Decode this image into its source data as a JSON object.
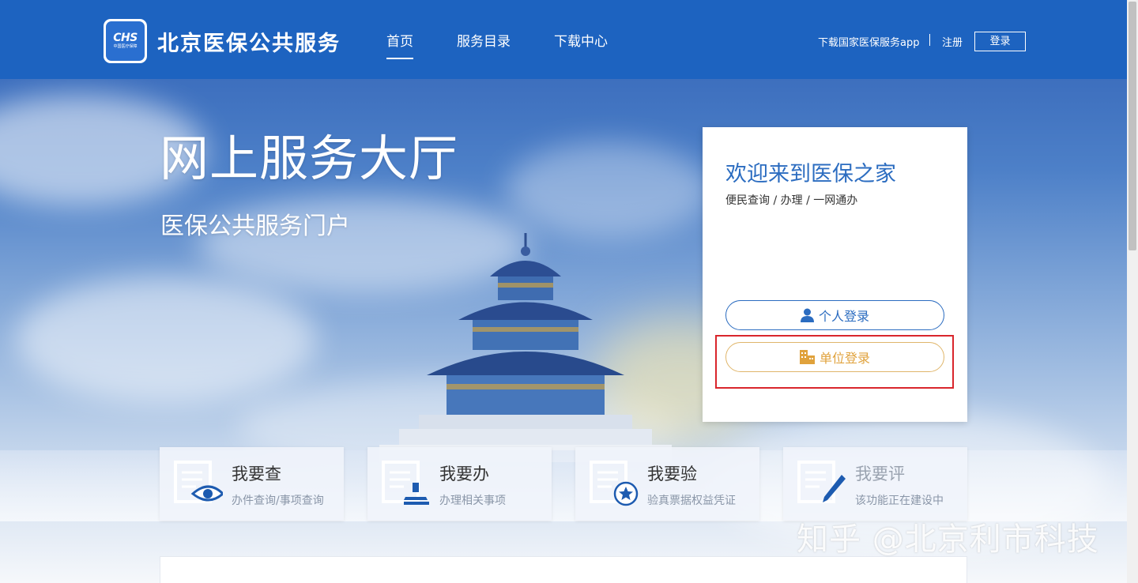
{
  "header": {
    "logo_text": "CHS",
    "logo_subtext": "中国医疗保障",
    "site_title": "北京医保公共服务",
    "nav": [
      {
        "label": "首页",
        "active": true
      },
      {
        "label": "服务目录",
        "active": false
      },
      {
        "label": "下载中心",
        "active": false
      }
    ],
    "download_app": "下载国家医保服务app",
    "register": "注册",
    "login": "登录"
  },
  "hero": {
    "title": "网上服务大厅",
    "subtitle": "医保公共服务门户"
  },
  "login_card": {
    "title": "欢迎来到医保之家",
    "subtitle": "便民查询 / 办理 / 一网通办",
    "personal_login": "个人登录",
    "unit_login": "单位登录"
  },
  "services": [
    {
      "name": "我要查",
      "desc": "办件查询/事项查询",
      "icon": "document-eye-icon"
    },
    {
      "name": "我要办",
      "desc": "办理相关事项",
      "icon": "document-stamp-icon"
    },
    {
      "name": "我要验",
      "desc": "验真票据权益凭证",
      "icon": "document-star-icon"
    },
    {
      "name": "我要评",
      "desc": "该功能正在建设中",
      "icon": "document-pen-icon"
    }
  ],
  "watermark": "知乎 @北京利市科技",
  "colors": {
    "header_bg": "#1d63c0",
    "primary": "#2b6cc0",
    "unit_accent": "#e0a23c",
    "highlight_border": "#d9262c"
  }
}
